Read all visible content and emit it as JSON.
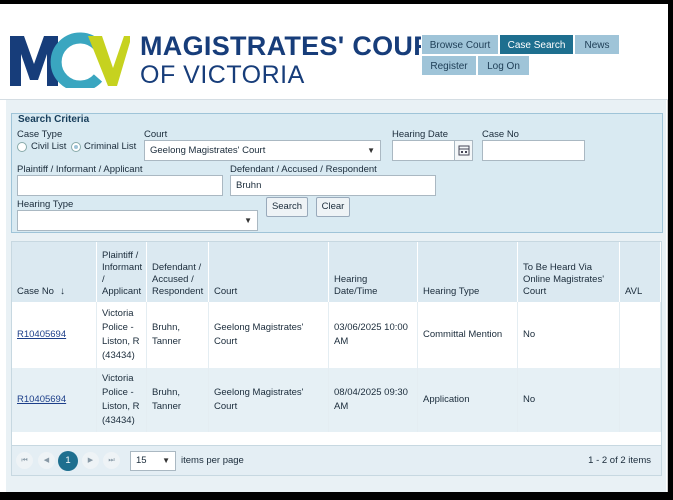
{
  "brand": {
    "logo_letters": "MCV",
    "line1": "MAGISTRATES' COURT",
    "line2": "OF VICTORIA"
  },
  "nav": {
    "browse_court": "Browse Court",
    "case_search": "Case Search",
    "news": "News",
    "register": "Register",
    "log_on": "Log On"
  },
  "criteria": {
    "title": "Search Criteria",
    "case_type_label": "Case Type",
    "civil_list": "Civil List",
    "criminal_list": "Criminal List",
    "selected_case_type": "Criminal List",
    "court_label": "Court",
    "court_value": "Geelong Magistrates' Court",
    "hearing_date_label": "Hearing Date",
    "hearing_date_value": "",
    "case_no_label": "Case No",
    "case_no_value": "",
    "plaintiff_label": "Plaintiff / Informant / Applicant",
    "plaintiff_value": "",
    "defendant_label": "Defendant / Accused / Respondent",
    "defendant_value": "Bruhn",
    "hearing_type_label": "Hearing Type",
    "hearing_type_value": "",
    "search_button": "Search",
    "clear_button": "Clear"
  },
  "results": {
    "headers": {
      "case_no": "Case No",
      "plaintiff": "Plaintiff / Informant / Applicant",
      "defendant": "Defendant / Accused / Respondent",
      "court": "Court",
      "hearing_date": "Hearing Date/Time",
      "hearing_type": "Hearing Type",
      "online": "To Be Heard Via Online Magistrates' Court",
      "avl": "AVL"
    },
    "rows": [
      {
        "case_no": "R10405694",
        "plaintiff": "Victoria Police - Liston, R (43434)",
        "defendant": "Bruhn, Tanner",
        "court": "Geelong Magistrates' Court",
        "hearing_date": "03/06/2025 10:00 AM",
        "hearing_type": "Committal Mention",
        "online": "No",
        "avl": ""
      },
      {
        "case_no": "R10405694",
        "plaintiff": "Victoria Police - Liston, R (43434)",
        "defendant": "Bruhn, Tanner",
        "court": "Geelong Magistrates' Court",
        "hearing_date": "08/04/2025 09:30 AM",
        "hearing_type": "Application",
        "online": "No",
        "avl": ""
      }
    ]
  },
  "pager": {
    "current_page": "1",
    "page_size": "15",
    "items_per_page_label": "items per page",
    "summary": "1 - 2 of 2 items"
  },
  "icons": {
    "sort": "arrow-down-icon",
    "calendar": "calendar-icon",
    "dropdown": "caret-down-icon"
  },
  "colors": {
    "brand_blue": "#173d7a",
    "nav_active": "#1e6f8f",
    "nav_inactive": "#9fc4d8",
    "logo_yellow": "#c6d21f",
    "logo_teal": "#3aa6c0"
  }
}
